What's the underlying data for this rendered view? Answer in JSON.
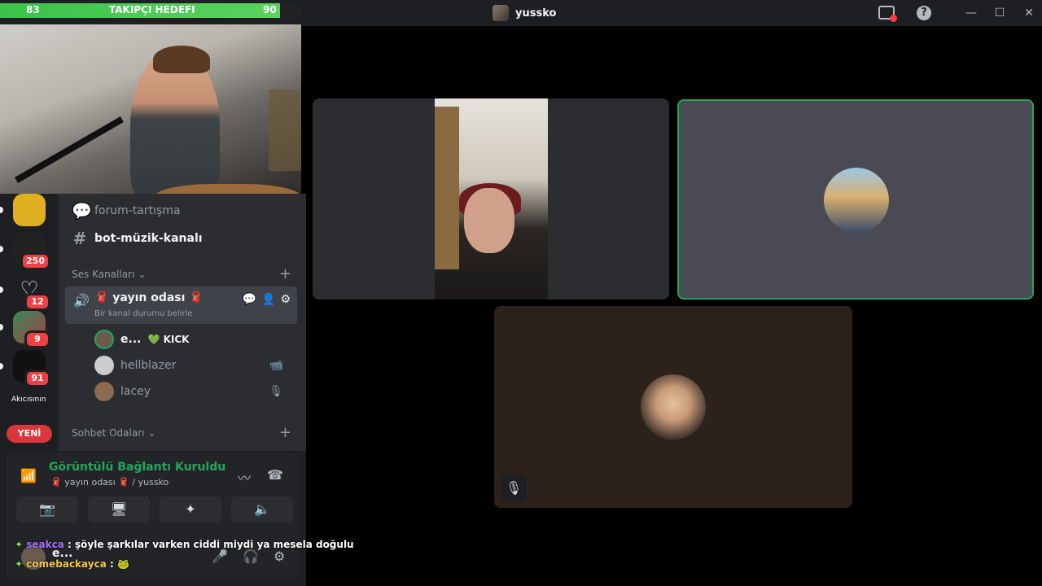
{
  "window": {
    "title": "yussko"
  },
  "goal": {
    "left": "83",
    "title": "TAKIPÇI HEDEFI",
    "right": "90",
    "progress_fraction": 0.93
  },
  "guilds": {
    "items": [
      {
        "badge": ""
      },
      {
        "badge": "250"
      },
      {
        "badge": "12"
      },
      {
        "badge": "9"
      },
      {
        "badge": "91"
      }
    ],
    "truncated_label": "Akıcısının",
    "new_label": "YENİ"
  },
  "channels": {
    "forum": "forum-tartışma",
    "bot_music": "bot-müzik-kanalı",
    "voice_category": "Ses Kanalları",
    "voice_channel": "🧣 yayın odası 🧣",
    "voice_status": "Bir kanal durumu belirle",
    "members": [
      {
        "name": "e...",
        "tag": "💚 KICK"
      },
      {
        "name": "hellblazer"
      },
      {
        "name": "lacey"
      }
    ],
    "chat_category": "Sohbet Odaları"
  },
  "connection": {
    "title": "Görüntülü Bağlantı Kuruldu",
    "subtitle": "🧣 yayın odası 🧣 / yussko"
  },
  "user": {
    "name": "e..."
  },
  "chat": [
    {
      "user": "seakca",
      "text": ": şöyle şarkılar varken ciddi miydi ya mesela doğulu"
    },
    {
      "user": "comebackayca",
      "text": ": 🐸"
    }
  ],
  "colors": {
    "accent_green": "#23a55a",
    "danger": "#f23f43",
    "bg_dark": "#1e1f22",
    "bg_sidebar": "#2b2d31"
  }
}
